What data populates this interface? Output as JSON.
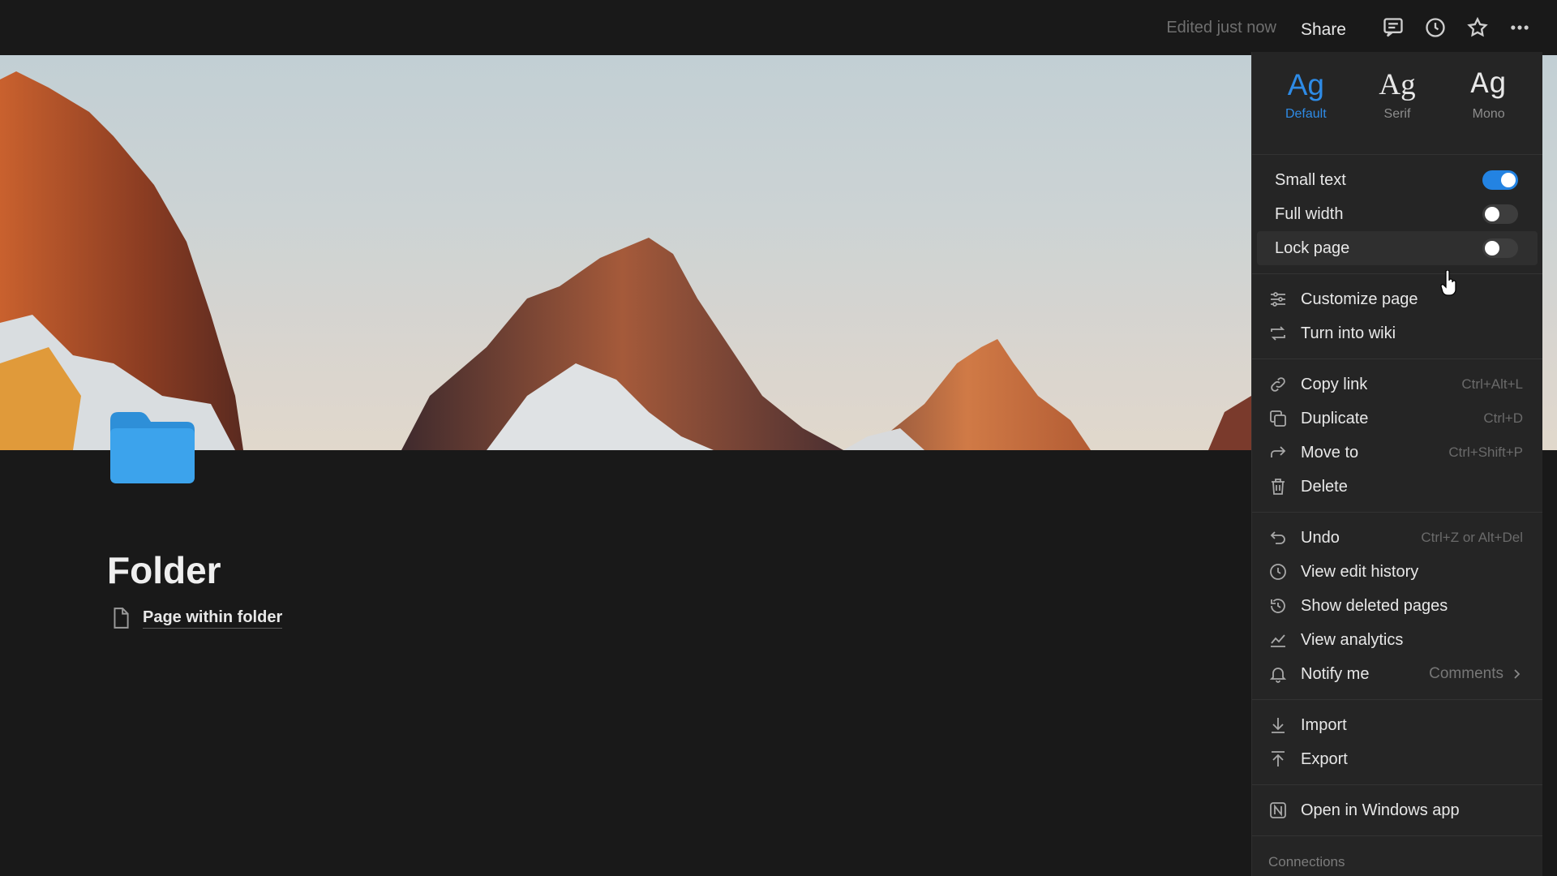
{
  "topbar": {
    "edited": "Edited just now",
    "share": "Share",
    "icons": [
      "comment-icon",
      "clock-icon",
      "star-icon",
      "more-icon"
    ]
  },
  "page": {
    "title": "Folder",
    "icon": "folder-icon",
    "subpage": "Page within folder"
  },
  "menu": {
    "fonts": [
      {
        "glyph": "Ag",
        "label": "Default",
        "active": true
      },
      {
        "glyph": "Ag",
        "label": "Serif",
        "active": false
      },
      {
        "glyph": "Ag",
        "label": "Mono",
        "active": false
      }
    ],
    "toggles": [
      {
        "label": "Small text",
        "on": true
      },
      {
        "label": "Full width",
        "on": false
      },
      {
        "label": "Lock page",
        "on": false
      }
    ],
    "group1": [
      {
        "label": "Customize page",
        "icon": "sliders-icon"
      },
      {
        "label": "Turn into wiki",
        "icon": "convert-icon"
      }
    ],
    "group2": [
      {
        "label": "Copy link",
        "icon": "link-icon",
        "shortcut": "Ctrl+Alt+L"
      },
      {
        "label": "Duplicate",
        "icon": "duplicate-icon",
        "shortcut": "Ctrl+D"
      },
      {
        "label": "Move to",
        "icon": "move-arrow-icon",
        "shortcut": "Ctrl+Shift+P"
      },
      {
        "label": "Delete",
        "icon": "trash-icon",
        "shortcut": ""
      }
    ],
    "group3": [
      {
        "label": "Undo",
        "icon": "undo-icon",
        "shortcut": "Ctrl+Z or Alt+Del"
      },
      {
        "label": "View edit history",
        "icon": "history-icon"
      },
      {
        "label": "Show deleted pages",
        "icon": "deleted-pages-icon"
      },
      {
        "label": "View analytics",
        "icon": "analytics-icon"
      },
      {
        "label": "Notify me",
        "icon": "bell-icon",
        "value": "Comments"
      }
    ],
    "group4": [
      {
        "label": "Import",
        "icon": "import-icon"
      },
      {
        "label": "Export",
        "icon": "export-icon"
      }
    ],
    "group5": [
      {
        "label": "Open in Windows app",
        "icon": "notion-app-icon"
      }
    ],
    "connections_label": "Connections"
  },
  "colors": {
    "accent": "#2383e2",
    "background": "#191919",
    "menu_bg": "#252525"
  }
}
